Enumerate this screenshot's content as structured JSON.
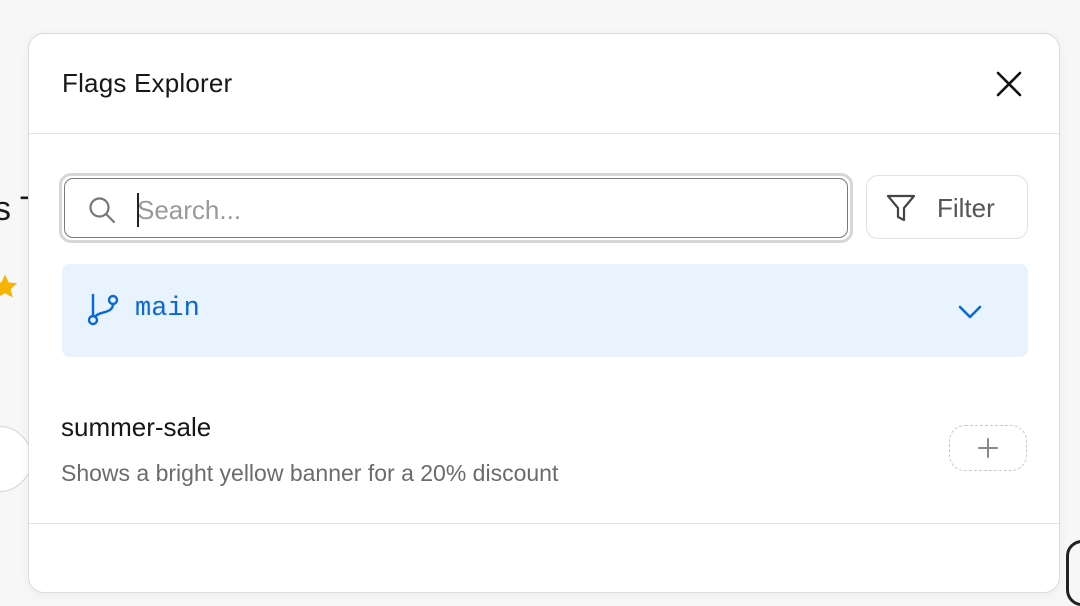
{
  "background": {
    "fragment_text": "s T",
    "star_color": "#f5b400"
  },
  "panel": {
    "title": "Flags Explorer",
    "close_icon": "close-icon"
  },
  "search": {
    "value": "",
    "placeholder": "Search...",
    "icon": "search-icon"
  },
  "filter": {
    "label": "Filter",
    "icon": "filter-icon"
  },
  "branch": {
    "name": "main",
    "icon": "git-branch-icon",
    "accent": "#0968da",
    "background": "#e8f3fe"
  },
  "flags": [
    {
      "name": "summer-sale",
      "description": "Shows a bright yellow banner for a 20% discount",
      "action_icon": "plus-icon"
    }
  ]
}
